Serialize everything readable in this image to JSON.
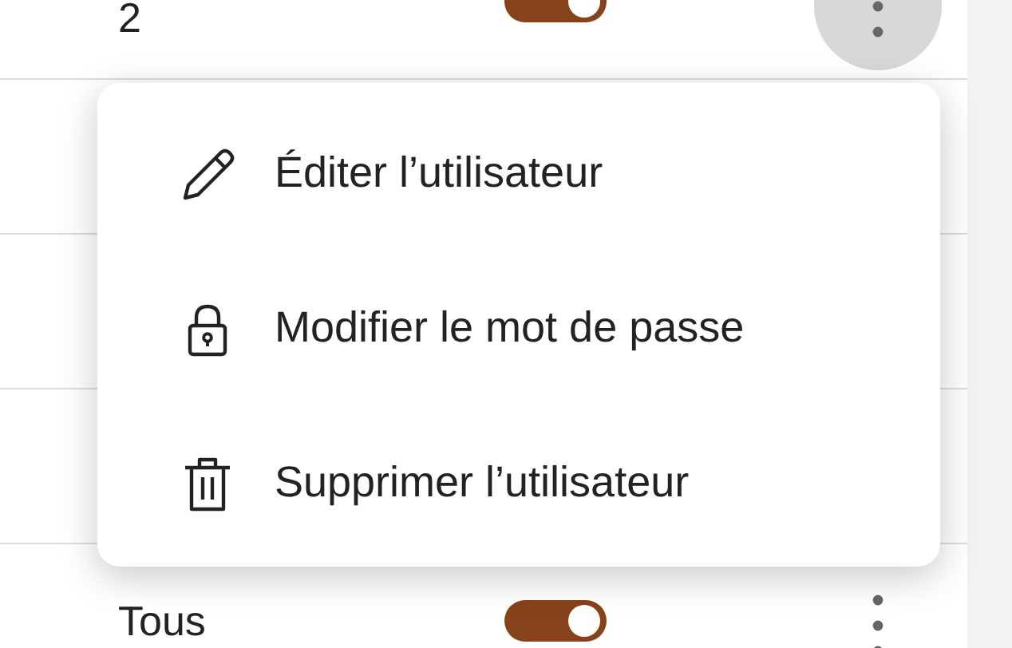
{
  "rows": [
    {
      "label": "2",
      "enabled": true,
      "menu_open": true
    },
    {
      "label": "Tous",
      "enabled": true,
      "menu_open": false
    }
  ],
  "menu": {
    "items": [
      {
        "kind": "edit",
        "label": "Éditer l’utilisateur"
      },
      {
        "kind": "password",
        "label": "Modifier le mot de passe"
      },
      {
        "kind": "delete",
        "label": "Supprimer l’utilisateur"
      }
    ]
  }
}
